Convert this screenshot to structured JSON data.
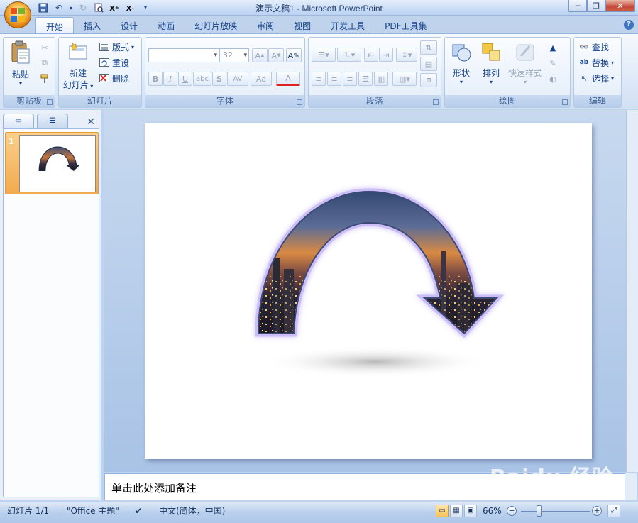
{
  "window": {
    "title": "演示文稿1 - Microsoft PowerPoint"
  },
  "quick_access": {
    "items": [
      "save-icon",
      "undo-icon",
      "redo-icon",
      "print-preview-icon",
      "custom-x-icon",
      "custom-x2-icon",
      "qat-dropdown-icon"
    ]
  },
  "tabs": [
    "开始",
    "插入",
    "设计",
    "动画",
    "幻灯片放映",
    "审阅",
    "视图",
    "开发工具",
    "PDF工具集"
  ],
  "active_tab": "开始",
  "ribbon": {
    "clipboard": {
      "label": "剪贴板",
      "paste": "粘贴"
    },
    "slides": {
      "label": "幻灯片",
      "new_slide_line1": "新建",
      "new_slide_line2": "幻灯片",
      "layout": "版式",
      "reset": "重设",
      "delete": "删除"
    },
    "font": {
      "label": "字体",
      "font_name": "",
      "font_size": "32",
      "bold": "B",
      "italic": "I",
      "underline": "U",
      "strike": "abc",
      "shadow": "S",
      "spacing": "AV",
      "case": "Aa",
      "color": "A"
    },
    "paragraph": {
      "label": "段落"
    },
    "drawing": {
      "label": "绘图",
      "shapes": "形状",
      "arrange": "排列",
      "quick_styles": "快速样式"
    },
    "editing": {
      "label": "编辑",
      "find": "查找",
      "replace": "替换",
      "select": "选择"
    }
  },
  "left_panel": {
    "slides": [
      {
        "number": "1"
      }
    ]
  },
  "notes": {
    "placeholder": "单击此处添加备注"
  },
  "status_bar": {
    "slide_info": "幻灯片 1/1",
    "theme": "\"Office 主题\"",
    "language": "中文(简体，中国)",
    "zoom": "66%"
  },
  "watermark": "Baidu 经验",
  "colors": {
    "ribbon_bg": "#dbe7f7",
    "accent": "#15428b",
    "slide_selected": "#f3a94d",
    "arrow_glow": "#b7a6f0"
  }
}
